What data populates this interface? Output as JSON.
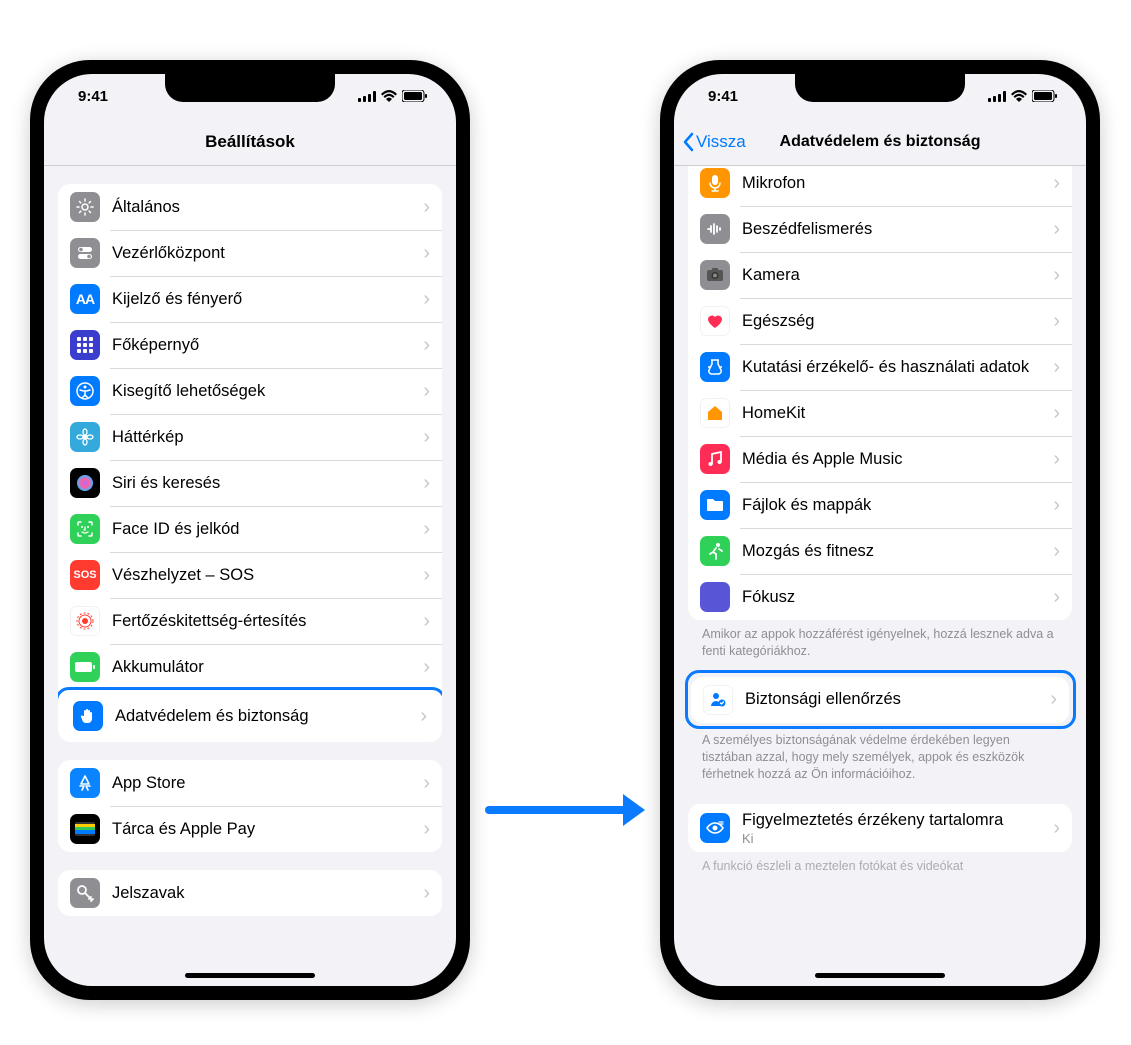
{
  "status": {
    "time": "9:41"
  },
  "left": {
    "title": "Beállítások",
    "group1": [
      {
        "label": "Általános",
        "icon": "gear",
        "bg": "#8e8e93"
      },
      {
        "label": "Vezérlőközpont",
        "icon": "switches",
        "bg": "#8e8e93"
      },
      {
        "label": "Kijelző és fényerő",
        "icon": "AA",
        "bg": "#007aff"
      },
      {
        "label": "Főképernyő",
        "icon": "grid",
        "bg": "#3a3dce"
      },
      {
        "label": "Kisegítő lehetőségek",
        "icon": "accessibility",
        "bg": "#007aff"
      },
      {
        "label": "Háttérkép",
        "icon": "flower",
        "bg": "#34aadc"
      },
      {
        "label": "Siri és keresés",
        "icon": "siri",
        "bg": "#000"
      },
      {
        "label": "Face ID és jelkód",
        "icon": "faceid",
        "bg": "#30d158"
      },
      {
        "label": "Vészhelyzet – SOS",
        "icon": "SOS",
        "bg": "#ff3b30"
      },
      {
        "label": "Fertőzéskitettség-értesítés",
        "icon": "exposure",
        "bg": "#fff",
        "fg": "#ff3b30"
      },
      {
        "label": "Akkumulátor",
        "icon": "battery",
        "bg": "#30d158"
      },
      {
        "label": "Adatvédelem és biztonság",
        "icon": "hand",
        "bg": "#007aff",
        "highlight": true
      }
    ],
    "group2": [
      {
        "label": "App Store",
        "icon": "appstore",
        "bg": "#0a84ff"
      },
      {
        "label": "Tárca és Apple Pay",
        "icon": "wallet",
        "bg": "#000"
      }
    ],
    "group3": [
      {
        "label": "Jelszavak",
        "icon": "key",
        "bg": "#8e8e93"
      }
    ]
  },
  "right": {
    "back": "Vissza",
    "title": "Adatvédelem és biztonság",
    "group1": [
      {
        "label": "Mikrofon",
        "icon": "mic",
        "bg": "#ff9500"
      },
      {
        "label": "Beszédfelismerés",
        "icon": "speech",
        "bg": "#8e8e93"
      },
      {
        "label": "Kamera",
        "icon": "camera",
        "bg": "#8e8e93"
      },
      {
        "label": "Egészség",
        "icon": "heart",
        "bg": "#fff",
        "fg": "#ff2d55"
      },
      {
        "label": "Kutatási érzékelő- és használati adatok",
        "icon": "research",
        "bg": "#007aff"
      },
      {
        "label": "HomeKit",
        "icon": "home",
        "bg": "#fff",
        "fg": "#ff9500"
      },
      {
        "label": "Média és Apple Music",
        "icon": "music",
        "bg": "#ff2d55"
      },
      {
        "label": "Fájlok és mappák",
        "icon": "folder",
        "bg": "#007aff"
      },
      {
        "label": "Mozgás és fitnesz",
        "icon": "fitness",
        "bg": "#30d158"
      },
      {
        "label": "Fókusz",
        "icon": "moon",
        "bg": "#5856d6"
      }
    ],
    "footer1": "Amikor az appok hozzáférést igényelnek, hozzá lesznek adva a fenti kategóriákhoz.",
    "group2": [
      {
        "label": "Biztonsági ellenőrzés",
        "icon": "safetycheck",
        "bg": "#fff",
        "fg": "#007aff",
        "highlight": true
      }
    ],
    "footer2": "A személyes biztonságának védelme érdekében legyen tisztában azzal, hogy mely személyek, appok és eszközök férhetnek hozzá az Ön információihoz.",
    "group3": [
      {
        "label": "Figyelmeztetés érzékeny tartalomra",
        "sub": "Ki",
        "icon": "eye",
        "bg": "#007aff"
      }
    ],
    "footer3": "A funkció észleli a meztelen fotókat és videókat"
  }
}
